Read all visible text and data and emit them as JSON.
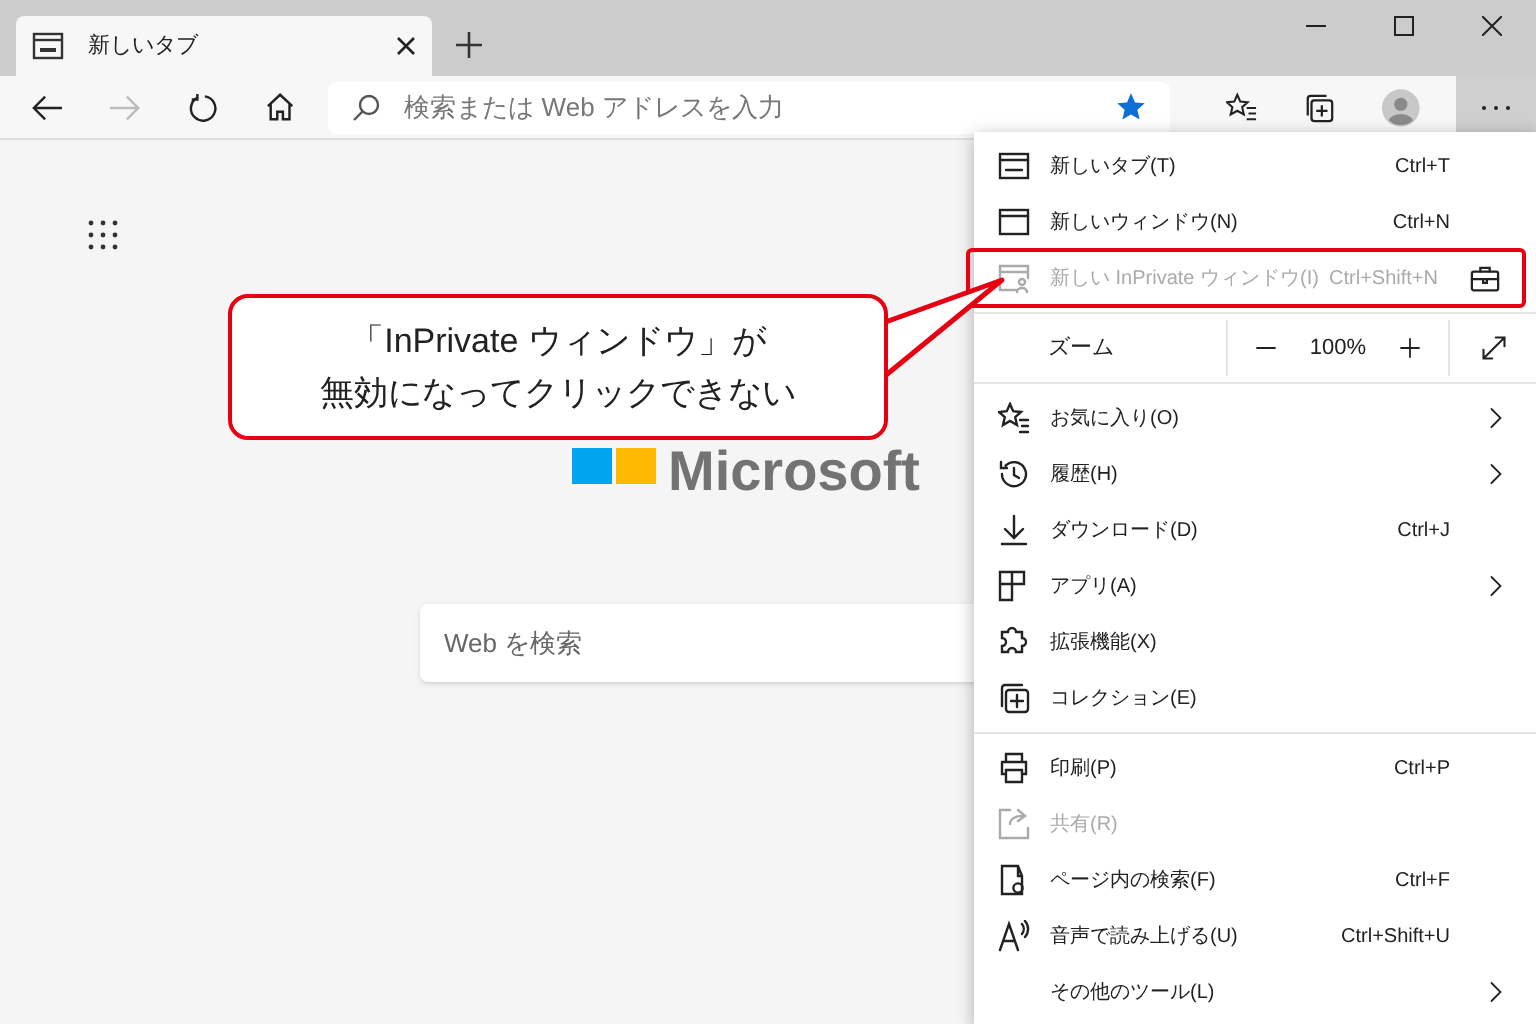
{
  "tab": {
    "title": "新しいタブ",
    "selected": true
  },
  "address_bar": {
    "placeholder": "検索または Web アドレスを入力"
  },
  "page": {
    "logo": "Microsoft",
    "search": {
      "placeholder": "Web を検索"
    }
  },
  "menu": {
    "sections": [
      [
        {
          "kind": "item",
          "label": "新しいタブ(T)",
          "shortcut": "Ctrl+T",
          "disabled": false
        },
        {
          "kind": "item",
          "label": "新しいウィンドウ(N)",
          "shortcut": "Ctrl+N",
          "disabled": false
        },
        {
          "kind": "item",
          "label": "新しい InPrivate ウィンドウ(I)",
          "shortcut": "Ctrl+Shift+N",
          "disabled": true,
          "highlighted": true,
          "managed": true
        }
      ],
      [
        {
          "kind": "zoom",
          "label": "ズーム",
          "value": "100%"
        }
      ],
      [
        {
          "kind": "item",
          "label": "お気に入り(O)",
          "submenu": true,
          "disabled": false
        },
        {
          "kind": "item",
          "label": "履歴(H)",
          "submenu": true,
          "disabled": false
        },
        {
          "kind": "item",
          "label": "ダウンロード(D)",
          "shortcut": "Ctrl+J",
          "disabled": false
        },
        {
          "kind": "item",
          "label": "アプリ(A)",
          "submenu": true,
          "disabled": false
        },
        {
          "kind": "item",
          "label": "拡張機能(X)",
          "disabled": false
        },
        {
          "kind": "item",
          "label": "コレクション(E)",
          "disabled": false
        }
      ],
      [
        {
          "kind": "item",
          "label": "印刷(P)",
          "shortcut": "Ctrl+P",
          "disabled": false
        },
        {
          "kind": "item",
          "label": "共有(R)",
          "disabled": true
        },
        {
          "kind": "item",
          "label": "ページ内の検索(F)",
          "shortcut": "Ctrl+F",
          "disabled": false
        },
        {
          "kind": "item",
          "label": "音声で読み上げる(U)",
          "shortcut": "Ctrl+Shift+U",
          "disabled": false
        },
        {
          "kind": "item",
          "label": "その他のツール(L)",
          "submenu": true,
          "disabled": false
        }
      ]
    ]
  },
  "callout": {
    "lines": [
      "「InPrivate ウィンドウ」が",
      "無効になってクリックできない"
    ]
  }
}
